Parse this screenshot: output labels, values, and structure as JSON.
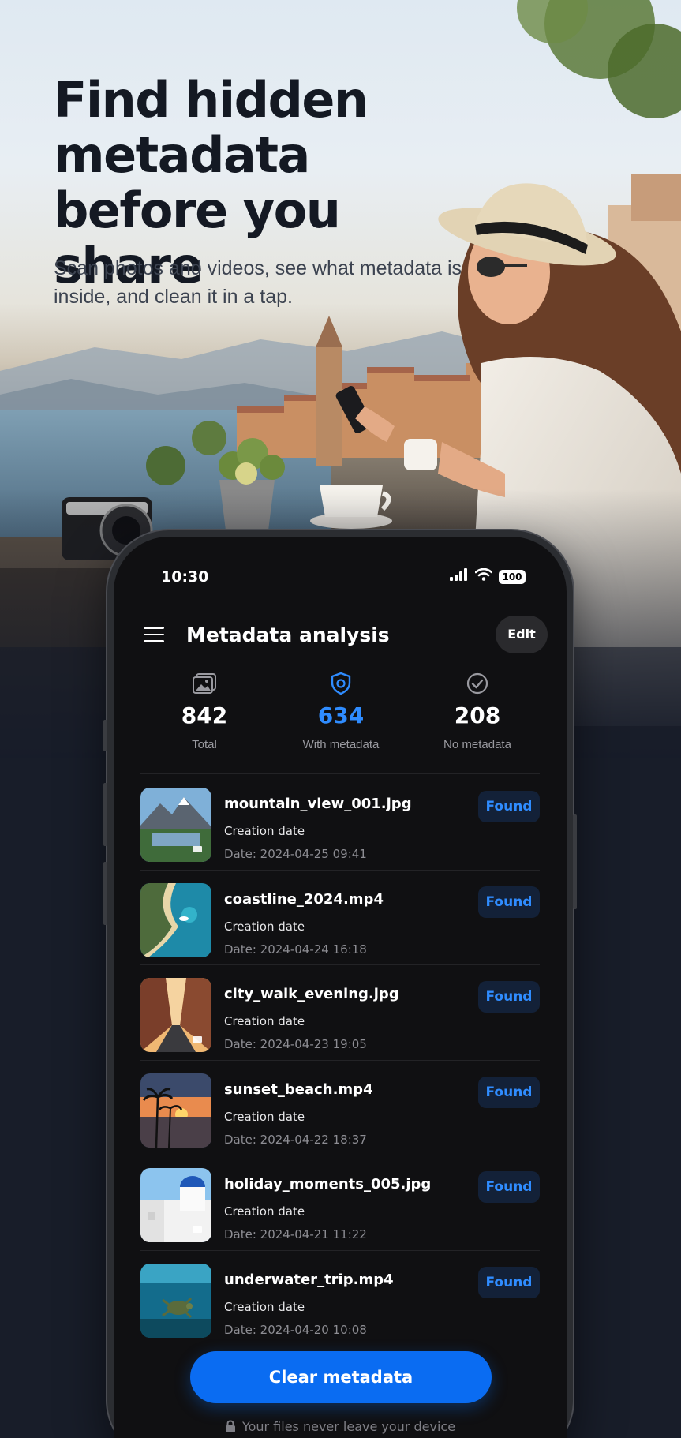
{
  "hero": {
    "headline": "Find hidden metadata before you share",
    "subline": "Scan photos and videos, see what metadata is inside, and clean it in a tap."
  },
  "status_bar": {
    "time": "10:30",
    "battery": "100",
    "icons": [
      "signal-icon",
      "wifi-icon",
      "battery-icon"
    ]
  },
  "app_bar": {
    "title": "Metadata analysis",
    "edit_label": "Edit"
  },
  "stats": [
    {
      "icon": "gallery-icon",
      "value": "842",
      "label": "Total"
    },
    {
      "icon": "shield-icon",
      "value": "634",
      "label": "With metadata"
    },
    {
      "icon": "check-circle-icon",
      "value": "208",
      "label": "No metadata"
    }
  ],
  "files": [
    {
      "name": "mountain_view_001.jpg",
      "kind": "Creation date",
      "date": "Date: 2024-04-25 09:41",
      "status": "Found"
    },
    {
      "name": "coastline_2024.mp4",
      "kind": "Creation date",
      "date": "Date: 2024-04-24 16:18",
      "status": "Found"
    },
    {
      "name": "city_walk_evening.jpg",
      "kind": "Creation date",
      "date": "Date: 2024-04-23 19:05",
      "status": "Found"
    },
    {
      "name": "sunset_beach.mp4",
      "kind": "Creation date",
      "date": "Date: 2024-04-22 18:37",
      "status": "Found"
    },
    {
      "name": "holiday_moments_005.jpg",
      "kind": "Creation date",
      "date": "Date: 2024-04-21 11:22",
      "status": "Found"
    },
    {
      "name": "underwater_trip.mp4",
      "kind": "Creation date",
      "date": "Date: 2024-04-20 10:08",
      "status": "Found"
    }
  ],
  "actions": {
    "clear_label": "Clear metadata"
  },
  "footer": {
    "note": "Your files never leave your device"
  },
  "colors": {
    "accent": "#0a6cf2",
    "accent_text": "#2f8cff",
    "screen_bg": "#101012",
    "page_bg": "#181d29"
  }
}
